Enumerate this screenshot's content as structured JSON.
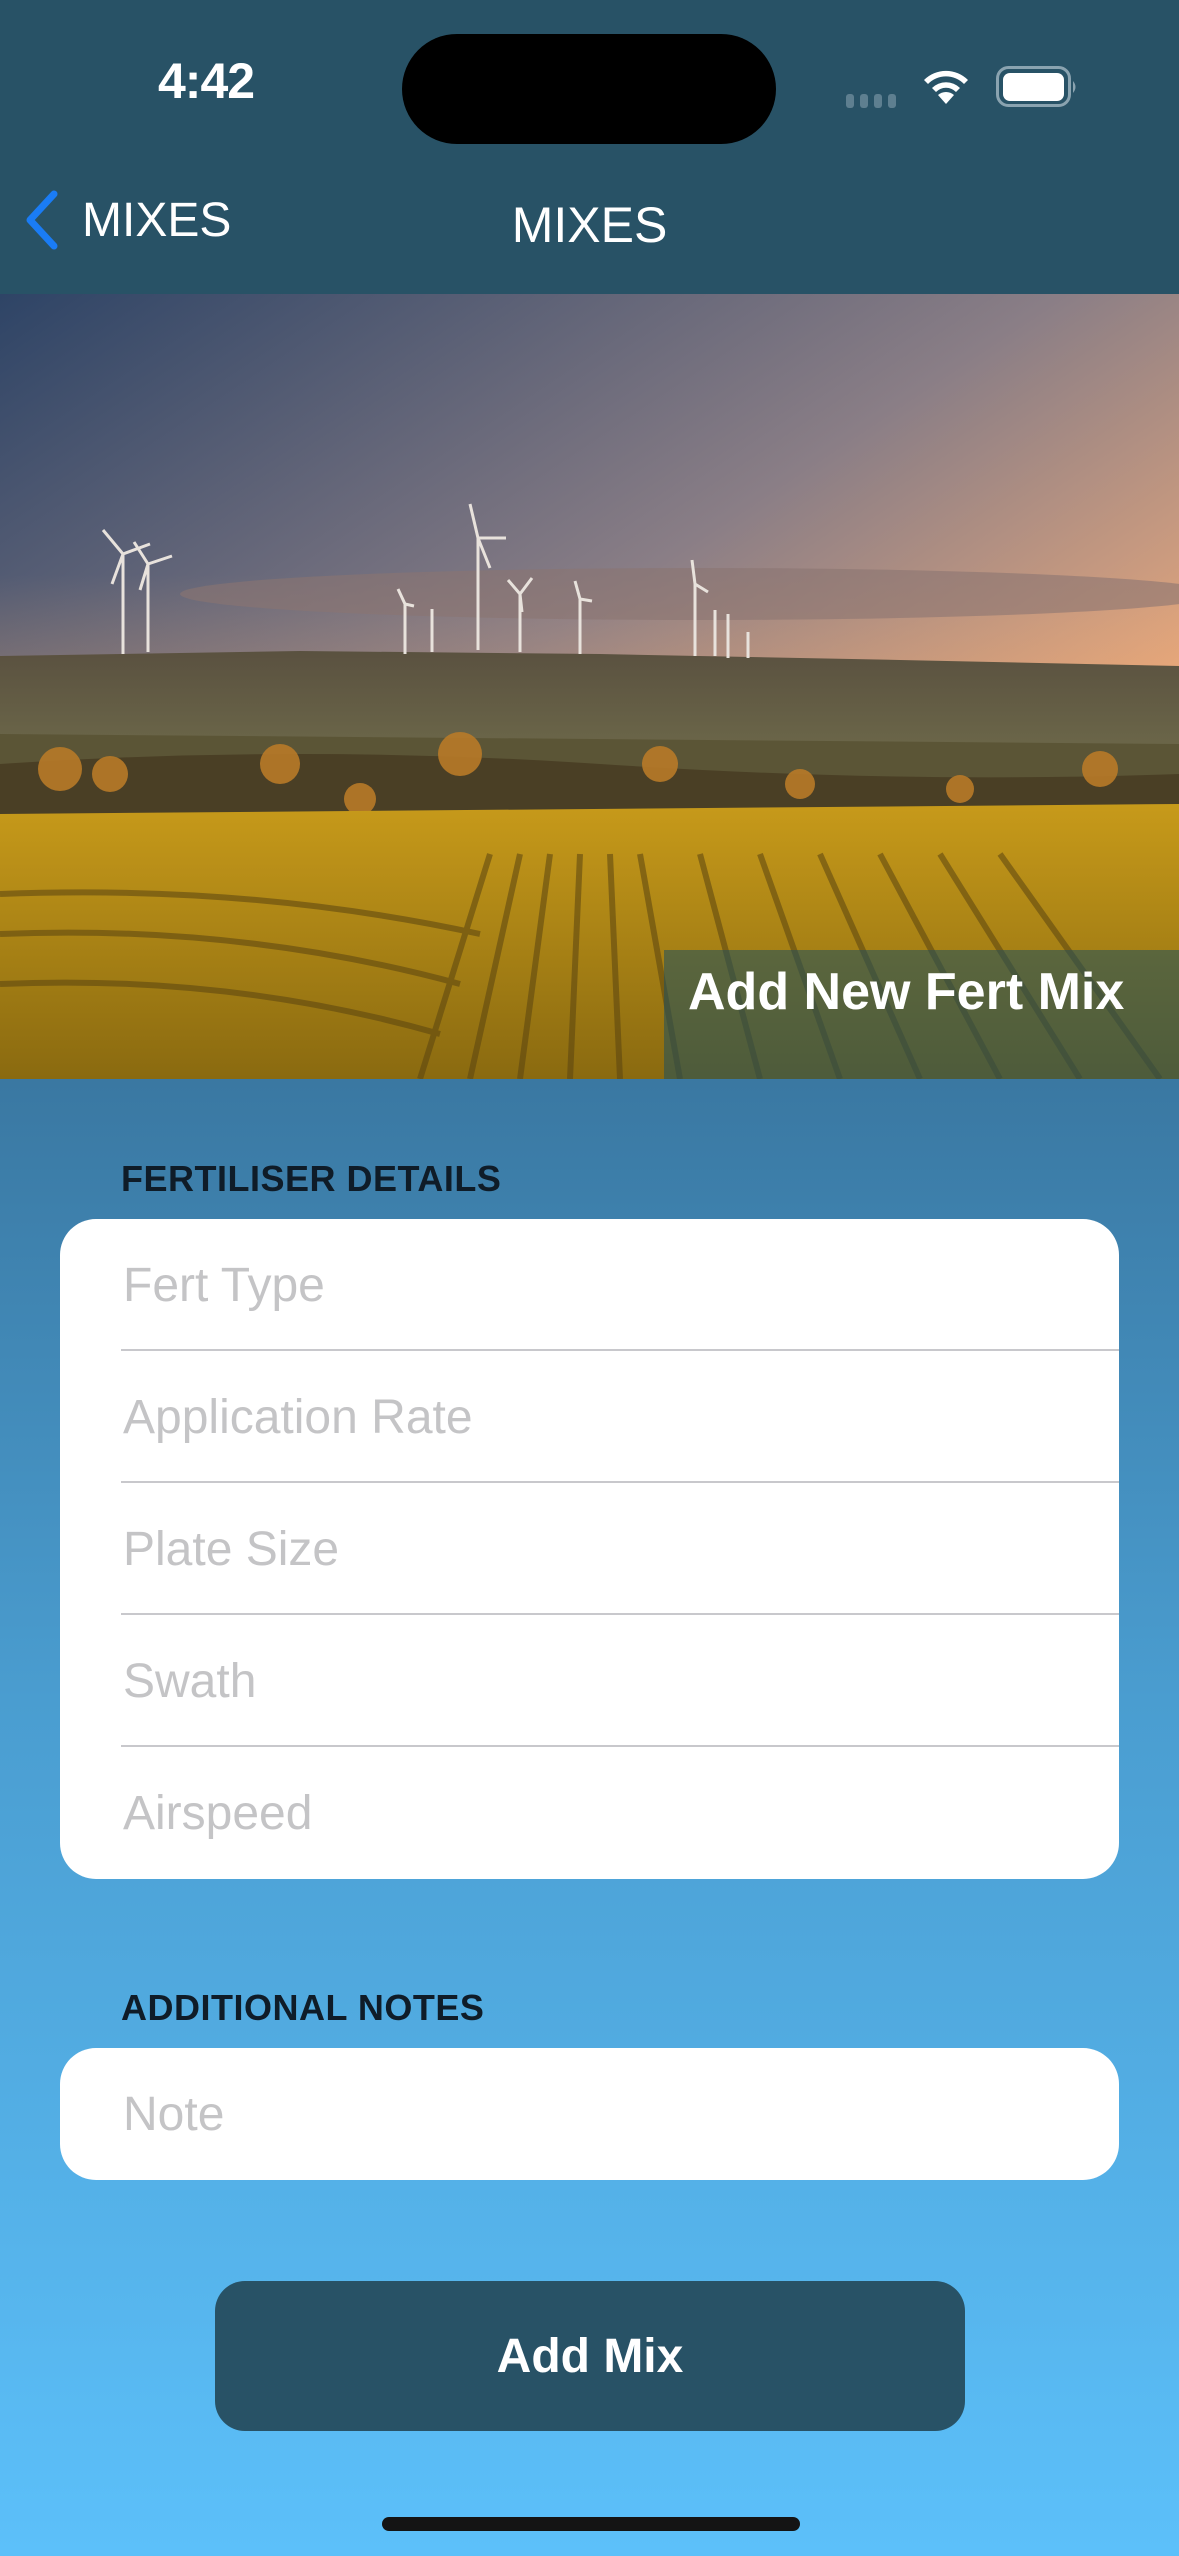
{
  "status_bar": {
    "time": "4:42"
  },
  "nav": {
    "back_label": "MIXES",
    "title": "MIXES",
    "accent_color": "#1a7cf5"
  },
  "hero": {
    "title": "Add New Fert Mix",
    "image_description": "sunset over vineyard with wind turbines"
  },
  "sections": {
    "fertiliser": {
      "header": "FERTILISER DETAILS",
      "fields": [
        {
          "placeholder": "Fert Type",
          "value": ""
        },
        {
          "placeholder": "Application Rate",
          "value": ""
        },
        {
          "placeholder": "Plate Size",
          "value": ""
        },
        {
          "placeholder": "Swath",
          "value": ""
        },
        {
          "placeholder": "Airspeed",
          "value": ""
        }
      ]
    },
    "notes": {
      "header": "ADDITIONAL NOTES",
      "field": {
        "placeholder": "Note",
        "value": ""
      }
    }
  },
  "actions": {
    "add_mix_label": "Add Mix"
  }
}
